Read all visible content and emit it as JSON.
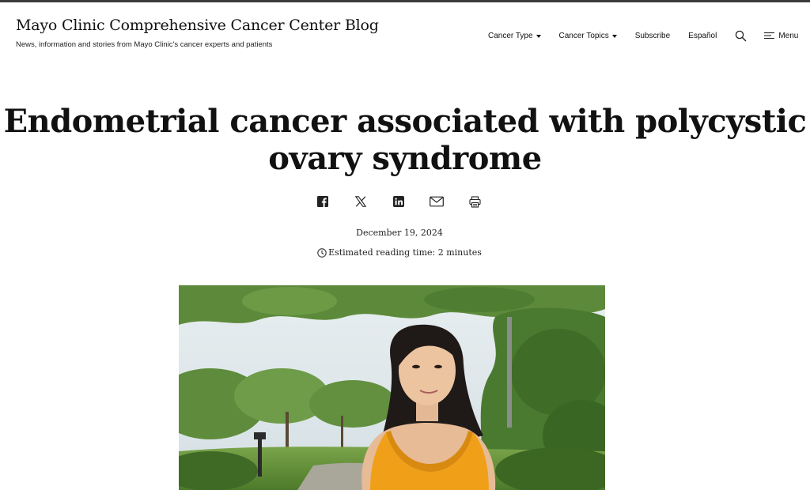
{
  "site": {
    "title": "Mayo Clinic Comprehensive Cancer Center Blog",
    "tagline": "News, information and stories from Mayo Clinic's cancer experts and patients"
  },
  "nav": {
    "cancer_type": "Cancer Type",
    "cancer_topics": "Cancer Topics",
    "subscribe": "Subscribe",
    "espanol": "Español",
    "search_icon": "search-icon",
    "menu_icon": "hamburger-icon",
    "menu": "Menu"
  },
  "article": {
    "headline_line1": "Endometrial cancer associated with polycystic",
    "headline_line2": "ovary syndrome",
    "date": "December 19, 2024",
    "reading_time": "Estimated reading time: 2 minutes",
    "hero_alt": "Woman in an orange top standing outdoors among green trees"
  },
  "share": {
    "icons": [
      "facebook-icon",
      "x-icon",
      "linkedin-icon",
      "email-icon",
      "print-icon"
    ]
  },
  "colors": {
    "text": "#111111",
    "top_bar": "#3a3a3a",
    "background": "#ffffff",
    "shirt": "#f0a018"
  }
}
